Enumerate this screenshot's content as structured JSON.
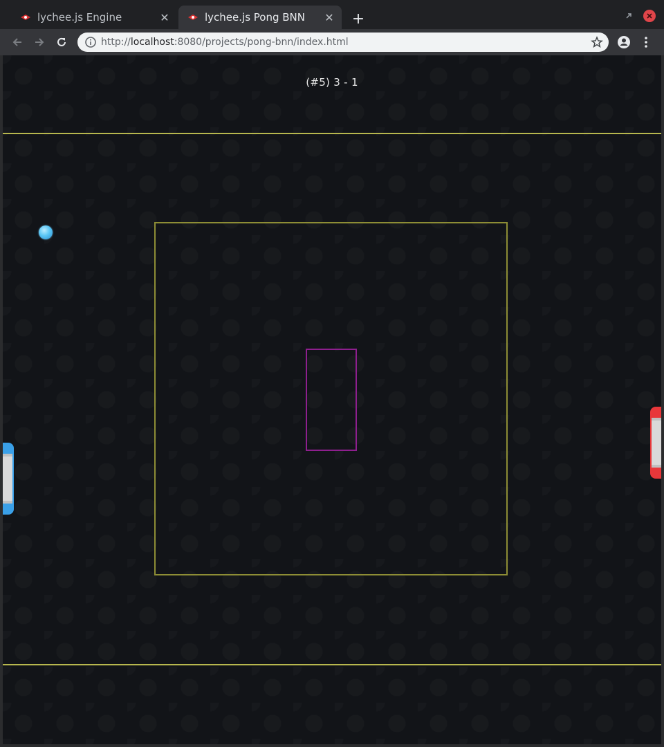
{
  "browser": {
    "tabs": [
      {
        "title": "lychee.js Engine",
        "active": false
      },
      {
        "title": "lychee.js Pong BNN",
        "active": true
      }
    ],
    "address": {
      "scheme": "http://",
      "host": "localhost",
      "rest": ":8080/projects/pong-bnn/index.html"
    }
  },
  "game": {
    "score_text": "(#5) 3 - 1",
    "colors": {
      "background": "#121418",
      "wall_line": "#b7b74e",
      "zone_outer": "#8d8d35",
      "zone_inner": "#8e1f8e",
      "player_paddle": "#3aa0e8",
      "enemy_paddle": "#e8373a",
      "ball": "#5ac6f5"
    }
  }
}
